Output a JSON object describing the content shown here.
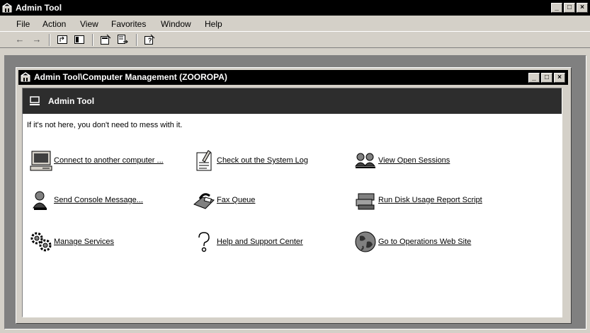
{
  "window": {
    "title": "Admin Tool",
    "buttons": [
      "_",
      "□",
      "×"
    ]
  },
  "menubar": [
    {
      "label": "File"
    },
    {
      "label": "Action"
    },
    {
      "label": "View"
    },
    {
      "label": "Favorites"
    },
    {
      "label": "Window"
    },
    {
      "label": "Help"
    }
  ],
  "toolbar": {
    "icons": [
      "back-arrow-icon",
      "forward-arrow-icon",
      "up-folder-icon",
      "show-hide-tree-icon",
      "properties-icon",
      "export-list-icon",
      "help-icon"
    ]
  },
  "child_window": {
    "title": "Admin Tool\\Computer Management (ZOOROPA)",
    "banner_title": "Admin Tool",
    "intro": "If it's not here, you don't need to mess with it.",
    "tasks": [
      {
        "label": "Connect to another computer ...",
        "icon": "computer-icon"
      },
      {
        "label": "Check out the System Log",
        "icon": "notepad-icon"
      },
      {
        "label": "View Open Sessions",
        "icon": "users-icon"
      },
      {
        "label": "Send Console Message...",
        "icon": "user-message-icon"
      },
      {
        "label": "Fax Queue",
        "icon": "fax-icon"
      },
      {
        "label": "Run Disk Usage Report Script",
        "icon": "disk-drives-icon"
      },
      {
        "label": "Manage Services",
        "icon": "gears-icon"
      },
      {
        "label": "Help and Support Center",
        "icon": "question-icon"
      },
      {
        "label": "Go to Operations Web Site",
        "icon": "globe-icon"
      }
    ]
  }
}
